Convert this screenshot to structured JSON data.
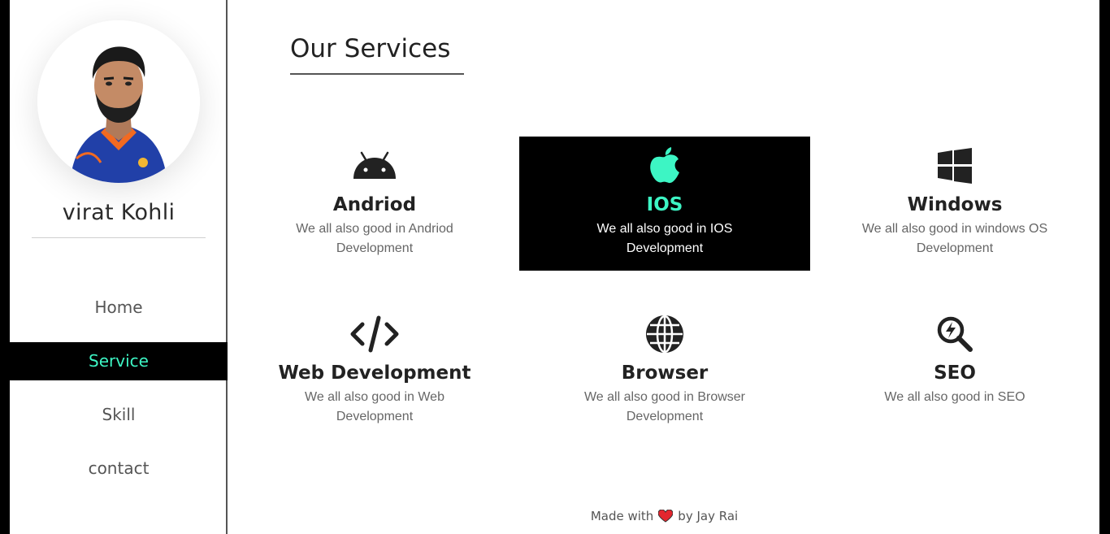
{
  "profile": {
    "name": "virat Kohli"
  },
  "nav": {
    "items": [
      {
        "label": "Home",
        "active": false
      },
      {
        "label": "Service",
        "active": true
      },
      {
        "label": "Skill",
        "active": false
      },
      {
        "label": "contact",
        "active": false
      }
    ]
  },
  "main": {
    "title": "Our Services",
    "services": [
      {
        "icon": "android-icon",
        "title": "Andriod",
        "description": "We all also good in Andriod Development"
      },
      {
        "icon": "apple-icon",
        "title": "IOS",
        "description": "We all also good in IOS Development"
      },
      {
        "icon": "windows-icon",
        "title": "Windows",
        "description": "We all also good in windows OS Development"
      },
      {
        "icon": "code-icon",
        "title": "Web Development",
        "description": "We all also good in Web Development"
      },
      {
        "icon": "globe-icon",
        "title": "Browser",
        "description": "We all also good in Browser Development"
      },
      {
        "icon": "seo-search-icon",
        "title": "SEO",
        "description": "We all also good in SEO"
      }
    ]
  },
  "footer": {
    "prefix": "Made with",
    "suffix": "by Jay Rai",
    "icon": "heart-icon"
  },
  "colors": {
    "accent": "#3df5c4",
    "highlight_bg": "#000000",
    "heart": "#e3262e"
  }
}
